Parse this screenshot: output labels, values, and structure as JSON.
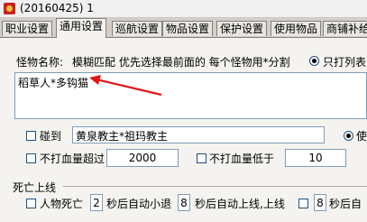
{
  "window": {
    "title": "(20160425) 1"
  },
  "tabs": [
    {
      "label": "职业设置"
    },
    {
      "label": "通用设置",
      "active": true
    },
    {
      "label": "巡航设置"
    },
    {
      "label": "物品设置"
    },
    {
      "label": "保护设置"
    },
    {
      "label": "使用物品"
    },
    {
      "label": "商铺补给"
    }
  ],
  "monster": {
    "label": "怪物名称:",
    "hint": "模糊匹配  优先选择最前面的 每个怪物用*分割",
    "radio_label": "只打列表",
    "list_value": "稻草人*多钩猫"
  },
  "touch": {
    "label": "碰到",
    "value": "黄泉教主*祖玛教主",
    "radio_label": "使"
  },
  "hp": {
    "above_label": "不打血量超过",
    "above_value": "2000",
    "below_label": "不打血量低于",
    "below_value": "10"
  },
  "death": {
    "section_label": "死亡上线",
    "dead_label": "人物死亡",
    "dead_seconds": "2",
    "dead_suffix": "秒后自动小退",
    "relog_seconds": "8",
    "relog_suffix": "秒后自动上线,上线",
    "extra_seconds": "8",
    "extra_suffix": "秒后自"
  },
  "colors": {
    "arrow": "#e01818",
    "input_border": "#7f9db9"
  },
  "icons": {
    "app": "app-icon",
    "arrow": "arrow-annotation"
  }
}
